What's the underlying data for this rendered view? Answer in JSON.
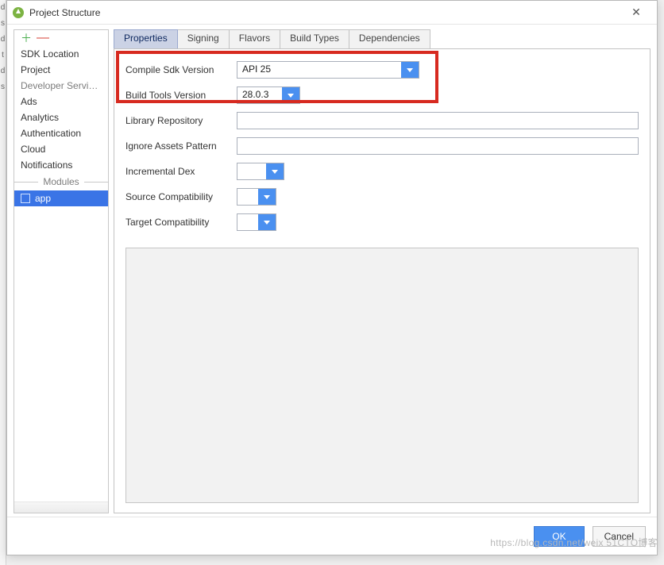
{
  "window": {
    "title": "Project Structure"
  },
  "sidebar": {
    "items": [
      {
        "label": "SDK Location",
        "type": "item"
      },
      {
        "label": "Project",
        "type": "item"
      },
      {
        "label": "Developer Services",
        "type": "group"
      },
      {
        "label": "Ads",
        "type": "item"
      },
      {
        "label": "Analytics",
        "type": "item"
      },
      {
        "label": "Authentication",
        "type": "item"
      },
      {
        "label": "Cloud",
        "type": "item"
      },
      {
        "label": "Notifications",
        "type": "item"
      }
    ],
    "modules_header": "Modules",
    "module": {
      "label": "app"
    }
  },
  "tabs": [
    {
      "label": "Properties",
      "active": true
    },
    {
      "label": "Signing",
      "active": false
    },
    {
      "label": "Flavors",
      "active": false
    },
    {
      "label": "Build Types",
      "active": false
    },
    {
      "label": "Dependencies",
      "active": false
    }
  ],
  "fields": {
    "compile_sdk": {
      "label": "Compile Sdk Version",
      "value": "API 25"
    },
    "build_tools": {
      "label": "Build Tools Version",
      "value": "28.0.3"
    },
    "library_repo": {
      "label": "Library Repository",
      "value": ""
    },
    "ignore_assets": {
      "label": "Ignore Assets Pattern",
      "value": ""
    },
    "incremental_dex": {
      "label": "Incremental Dex",
      "value": ""
    },
    "source_compat": {
      "label": "Source Compatibility",
      "value": ""
    },
    "target_compat": {
      "label": "Target Compatibility",
      "value": ""
    }
  },
  "footer": {
    "ok": "OK",
    "cancel": "Cancel"
  },
  "watermark": "https://blog.csdn.net/weix 51CTO博客"
}
